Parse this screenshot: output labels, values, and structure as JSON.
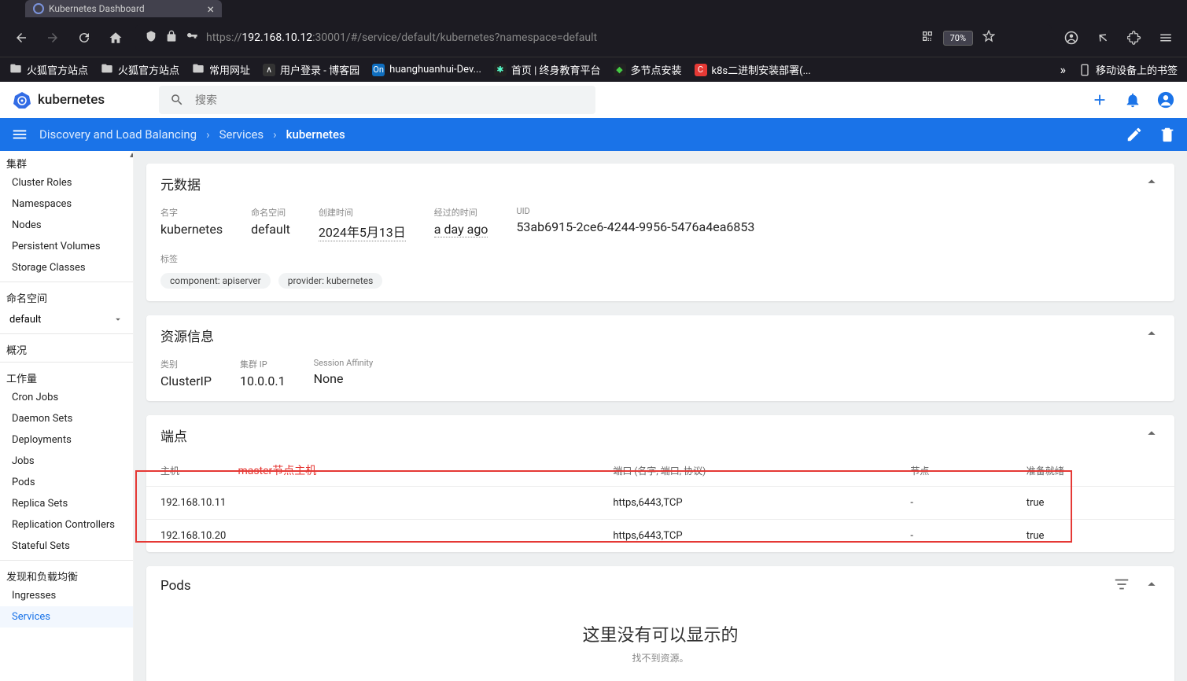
{
  "browser": {
    "tab_title": "Kubernetes Dashboard",
    "url_prefix": "https://",
    "url_host": "192.168.10.12",
    "url_path": ":30001/#/service/default/kubernetes?namespace=default",
    "zoom": "70%",
    "bookmarks": [
      {
        "label": "火狐官方站点",
        "type": "folder"
      },
      {
        "label": "火狐官方站点",
        "type": "folder"
      },
      {
        "label": "常用网址",
        "type": "folder"
      },
      {
        "label": "用户登录 - 博客园",
        "icon": "∧",
        "bg": "#333",
        "fg": "#fff"
      },
      {
        "label": "huanghuanhui-Dev...",
        "icon": "On",
        "bg": "#0f6ebf",
        "fg": "#fff"
      },
      {
        "label": "首页 | 终身教育平台",
        "icon": "✱",
        "bg": "#222",
        "fg": "#5fc"
      },
      {
        "label": "多节点安装",
        "icon": "◆",
        "bg": "#222",
        "fg": "#4c4"
      },
      {
        "label": "k8s二进制安装部署(...",
        "icon": "C",
        "bg": "#e53935",
        "fg": "#fff"
      }
    ],
    "devices_bookmark": "移动设备上的书签"
  },
  "header": {
    "brand": "kubernetes",
    "search_placeholder": "搜索"
  },
  "breadcrumbs": {
    "items": [
      "Discovery and Load Balancing",
      "Services",
      "kubernetes"
    ],
    "sep": "›"
  },
  "sidebar": {
    "sections": [
      {
        "title": "集群",
        "items": [
          "Cluster Roles",
          "Namespaces",
          "Nodes",
          "Persistent Volumes",
          "Storage Classes"
        ]
      },
      {
        "title": "命名空间",
        "namespace": "default"
      },
      {
        "title": "概况"
      },
      {
        "title": "工作量",
        "items": [
          "Cron Jobs",
          "Daemon Sets",
          "Deployments",
          "Jobs",
          "Pods",
          "Replica Sets",
          "Replication Controllers",
          "Stateful Sets"
        ]
      },
      {
        "title": "发现和负载均衡",
        "items": [
          "Ingresses",
          "Services"
        ]
      }
    ],
    "active": "Services"
  },
  "metadata": {
    "card_title": "元数据",
    "name_label": "名字",
    "name_value": "kubernetes",
    "ns_label": "命名空间",
    "ns_value": "default",
    "created_label": "创建时间",
    "created_value": "2024年5月13日",
    "age_label": "经过的时间",
    "age_value": "a day ago",
    "uid_label": "UID",
    "uid_value": "53ab6915-2ce6-4244-9956-5476a4ea6853",
    "labels_label": "标签",
    "chips": [
      "component: apiserver",
      "provider: kubernetes"
    ]
  },
  "resource": {
    "card_title": "资源信息",
    "type_label": "类别",
    "type_value": "ClusterIP",
    "cip_label": "集群 IP",
    "cip_value": "10.0.0.1",
    "sa_label": "Session Affinity",
    "sa_value": "None"
  },
  "endpoints": {
    "card_title": "端点",
    "annotation": "master节点主机",
    "cols": [
      "主机",
      "端口 (名字, 端口, 协议)",
      "节点",
      "准备就绪"
    ],
    "rows": [
      {
        "host": "192.168.10.11",
        "port": "https,6443,TCP",
        "node": "-",
        "ready": "true"
      },
      {
        "host": "192.168.10.20",
        "port": "https,6443,TCP",
        "node": "-",
        "ready": "true"
      }
    ]
  },
  "pods": {
    "card_title": "Pods",
    "empty_title": "这里没有可以显示的",
    "empty_sub": "找不到资源。"
  }
}
